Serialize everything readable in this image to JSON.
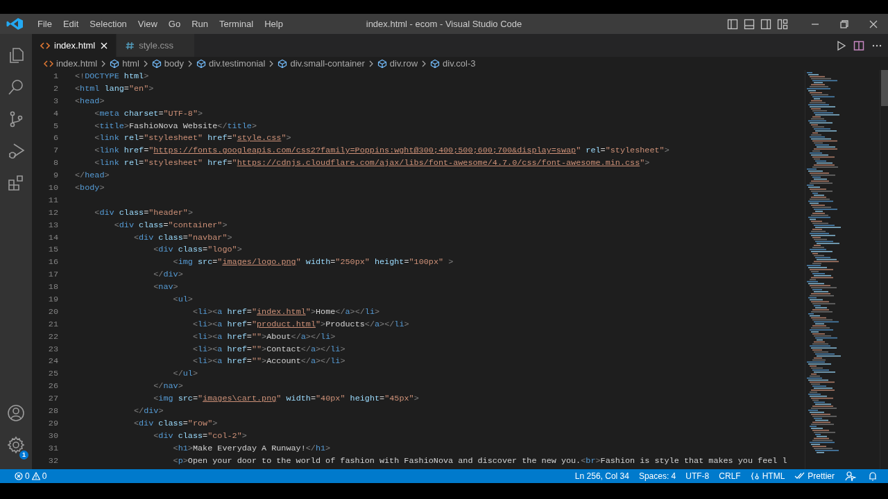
{
  "window": {
    "title": "index.html - ecom - Visual Studio Code"
  },
  "menu": [
    "File",
    "Edit",
    "Selection",
    "View",
    "Go",
    "Run",
    "Terminal",
    "Help"
  ],
  "activity_bar": {
    "settings_badge": "1"
  },
  "tabs": [
    {
      "label": "index.html",
      "kind": "html",
      "selected": true
    },
    {
      "label": "style.css",
      "kind": "css",
      "selected": false
    }
  ],
  "breadcrumbs": [
    {
      "label": "index.html",
      "kind": "file"
    },
    {
      "label": "html",
      "kind": "element"
    },
    {
      "label": "body",
      "kind": "element"
    },
    {
      "label": "div.testimonial",
      "kind": "element"
    },
    {
      "label": "div.small-container",
      "kind": "element"
    },
    {
      "label": "div.row",
      "kind": "element"
    },
    {
      "label": "div.col-3",
      "kind": "element"
    }
  ],
  "editor": {
    "lines": [
      {
        "number": "1",
        "tokens": [
          {
            "kind": "bracket",
            "text": "<!"
          },
          {
            "kind": "tag",
            "text": "DOCTYPE"
          },
          {
            "kind": "attr",
            "text": " html"
          },
          {
            "kind": "bracket",
            "text": ">"
          }
        ]
      },
      {
        "number": "2",
        "tokens": [
          {
            "kind": "bracket",
            "text": "<"
          },
          {
            "kind": "tag",
            "text": "html"
          },
          {
            "kind": "attr",
            "text": " lang"
          },
          {
            "kind": "text",
            "text": "="
          },
          {
            "kind": "string",
            "text": "\"en\""
          },
          {
            "kind": "bracket",
            "text": ">"
          }
        ]
      },
      {
        "number": "3",
        "tokens": [
          {
            "kind": "bracket",
            "text": "<"
          },
          {
            "kind": "tag",
            "text": "head"
          },
          {
            "kind": "bracket",
            "text": ">"
          }
        ]
      },
      {
        "number": "4",
        "tokens": [
          {
            "kind": "bracket",
            "text": "    <"
          },
          {
            "kind": "tag",
            "text": "meta"
          },
          {
            "kind": "attr",
            "text": " charset"
          },
          {
            "kind": "text",
            "text": "="
          },
          {
            "kind": "string",
            "text": "\"UTF-8\""
          },
          {
            "kind": "bracket",
            "text": ">"
          }
        ]
      },
      {
        "number": "5",
        "tokens": [
          {
            "kind": "bracket",
            "text": "    <"
          },
          {
            "kind": "tag",
            "text": "title"
          },
          {
            "kind": "bracket",
            "text": ">"
          },
          {
            "kind": "text",
            "text": "FashioNova Website"
          },
          {
            "kind": "bracket",
            "text": "</"
          },
          {
            "kind": "tag",
            "text": "title"
          },
          {
            "kind": "bracket",
            "text": ">"
          }
        ]
      },
      {
        "number": "6",
        "tokens": [
          {
            "kind": "bracket",
            "text": "    <"
          },
          {
            "kind": "tag",
            "text": "link"
          },
          {
            "kind": "attr",
            "text": " rel"
          },
          {
            "kind": "text",
            "text": "="
          },
          {
            "kind": "string",
            "text": "\"stylesheet\""
          },
          {
            "kind": "attr",
            "text": " href"
          },
          {
            "kind": "text",
            "text": "="
          },
          {
            "kind": "string",
            "text": "\""
          },
          {
            "kind": "link",
            "text": "style.css"
          },
          {
            "kind": "string",
            "text": "\""
          },
          {
            "kind": "bracket",
            "text": ">"
          }
        ]
      },
      {
        "number": "7",
        "tokens": [
          {
            "kind": "bracket",
            "text": "    <"
          },
          {
            "kind": "tag",
            "text": "link"
          },
          {
            "kind": "attr",
            "text": " href"
          },
          {
            "kind": "text",
            "text": "="
          },
          {
            "kind": "string",
            "text": "\""
          },
          {
            "kind": "link",
            "text": "https://fonts.googleapis.com/css2?family=Poppins:wght@300;400;500;600;700&display=swap"
          },
          {
            "kind": "string",
            "text": "\""
          },
          {
            "kind": "attr",
            "text": " rel"
          },
          {
            "kind": "text",
            "text": "="
          },
          {
            "kind": "string",
            "text": "\"stylesheet\""
          },
          {
            "kind": "bracket",
            "text": ">"
          }
        ]
      },
      {
        "number": "8",
        "tokens": [
          {
            "kind": "bracket",
            "text": "    <"
          },
          {
            "kind": "tag",
            "text": "link"
          },
          {
            "kind": "attr",
            "text": " rel"
          },
          {
            "kind": "text",
            "text": "="
          },
          {
            "kind": "string",
            "text": "\"stylesheet\""
          },
          {
            "kind": "attr",
            "text": " href"
          },
          {
            "kind": "text",
            "text": "="
          },
          {
            "kind": "string",
            "text": "\""
          },
          {
            "kind": "link",
            "text": "https://cdnjs.cloudflare.com/ajax/libs/font-awesome/4.7.0/css/font-awesome.min.css"
          },
          {
            "kind": "string",
            "text": "\""
          },
          {
            "kind": "bracket",
            "text": ">"
          }
        ]
      },
      {
        "number": "9",
        "tokens": [
          {
            "kind": "bracket",
            "text": "</"
          },
          {
            "kind": "tag",
            "text": "head"
          },
          {
            "kind": "bracket",
            "text": ">"
          }
        ]
      },
      {
        "number": "10",
        "tokens": [
          {
            "kind": "bracket",
            "text": "<"
          },
          {
            "kind": "tag",
            "text": "body"
          },
          {
            "kind": "bracket",
            "text": ">"
          }
        ]
      },
      {
        "number": "11"
      },
      {
        "number": "12",
        "tokens": [
          {
            "kind": "bracket",
            "text": "    <"
          },
          {
            "kind": "tag",
            "text": "div"
          },
          {
            "kind": "attr",
            "text": " class"
          },
          {
            "kind": "text",
            "text": "="
          },
          {
            "kind": "string",
            "text": "\"header\""
          },
          {
            "kind": "bracket",
            "text": ">"
          }
        ]
      },
      {
        "number": "13",
        "tokens": [
          {
            "kind": "bracket",
            "text": "        <"
          },
          {
            "kind": "tag",
            "text": "div"
          },
          {
            "kind": "attr",
            "text": " class"
          },
          {
            "kind": "text",
            "text": "="
          },
          {
            "kind": "string",
            "text": "\"container\""
          },
          {
            "kind": "bracket",
            "text": ">"
          }
        ]
      },
      {
        "number": "14",
        "tokens": [
          {
            "kind": "bracket",
            "text": "            <"
          },
          {
            "kind": "tag",
            "text": "div"
          },
          {
            "kind": "attr",
            "text": " class"
          },
          {
            "kind": "text",
            "text": "="
          },
          {
            "kind": "string",
            "text": "\"navbar\""
          },
          {
            "kind": "bracket",
            "text": ">"
          }
        ]
      },
      {
        "number": "15",
        "tokens": [
          {
            "kind": "bracket",
            "text": "                <"
          },
          {
            "kind": "tag",
            "text": "div"
          },
          {
            "kind": "attr",
            "text": " class"
          },
          {
            "kind": "text",
            "text": "="
          },
          {
            "kind": "string",
            "text": "\"logo\""
          },
          {
            "kind": "bracket",
            "text": ">"
          }
        ]
      },
      {
        "number": "16",
        "tokens": [
          {
            "kind": "bracket",
            "text": "                    <"
          },
          {
            "kind": "tag",
            "text": "img"
          },
          {
            "kind": "attr",
            "text": " src"
          },
          {
            "kind": "text",
            "text": "="
          },
          {
            "kind": "string",
            "text": "\""
          },
          {
            "kind": "link",
            "text": "images/logo.png"
          },
          {
            "kind": "string",
            "text": "\""
          },
          {
            "kind": "attr",
            "text": " width"
          },
          {
            "kind": "text",
            "text": "="
          },
          {
            "kind": "string",
            "text": "\"250px\""
          },
          {
            "kind": "attr",
            "text": " height"
          },
          {
            "kind": "text",
            "text": "="
          },
          {
            "kind": "string",
            "text": "\"100px\""
          },
          {
            "kind": "bracket",
            "text": " >"
          }
        ]
      },
      {
        "number": "17",
        "tokens": [
          {
            "kind": "bracket",
            "text": "                </"
          },
          {
            "kind": "tag",
            "text": "div"
          },
          {
            "kind": "bracket",
            "text": ">"
          }
        ]
      },
      {
        "number": "18",
        "tokens": [
          {
            "kind": "bracket",
            "text": "                <"
          },
          {
            "kind": "tag",
            "text": "nav"
          },
          {
            "kind": "bracket",
            "text": ">"
          }
        ]
      },
      {
        "number": "19",
        "tokens": [
          {
            "kind": "bracket",
            "text": "                    <"
          },
          {
            "kind": "tag",
            "text": "ul"
          },
          {
            "kind": "bracket",
            "text": ">"
          }
        ]
      },
      {
        "number": "20",
        "tokens": [
          {
            "kind": "bracket",
            "text": "                        <"
          },
          {
            "kind": "tag",
            "text": "li"
          },
          {
            "kind": "bracket",
            "text": "><"
          },
          {
            "kind": "tag",
            "text": "a"
          },
          {
            "kind": "attr",
            "text": " href"
          },
          {
            "kind": "text",
            "text": "="
          },
          {
            "kind": "string",
            "text": "\""
          },
          {
            "kind": "link",
            "text": "index.html"
          },
          {
            "kind": "string",
            "text": "\""
          },
          {
            "kind": "bracket",
            "text": ">"
          },
          {
            "kind": "text",
            "text": "Home"
          },
          {
            "kind": "bracket",
            "text": "</"
          },
          {
            "kind": "tag",
            "text": "a"
          },
          {
            "kind": "bracket",
            "text": "></"
          },
          {
            "kind": "tag",
            "text": "li"
          },
          {
            "kind": "bracket",
            "text": ">"
          }
        ]
      },
      {
        "number": "21",
        "tokens": [
          {
            "kind": "bracket",
            "text": "                        <"
          },
          {
            "kind": "tag",
            "text": "li"
          },
          {
            "kind": "bracket",
            "text": "><"
          },
          {
            "kind": "tag",
            "text": "a"
          },
          {
            "kind": "attr",
            "text": " href"
          },
          {
            "kind": "text",
            "text": "="
          },
          {
            "kind": "string",
            "text": "\""
          },
          {
            "kind": "link",
            "text": "product.html"
          },
          {
            "kind": "string",
            "text": "\""
          },
          {
            "kind": "bracket",
            "text": ">"
          },
          {
            "kind": "text",
            "text": "Products"
          },
          {
            "kind": "bracket",
            "text": "</"
          },
          {
            "kind": "tag",
            "text": "a"
          },
          {
            "kind": "bracket",
            "text": "></"
          },
          {
            "kind": "tag",
            "text": "li"
          },
          {
            "kind": "bracket",
            "text": ">"
          }
        ]
      },
      {
        "number": "22",
        "tokens": [
          {
            "kind": "bracket",
            "text": "                        <"
          },
          {
            "kind": "tag",
            "text": "li"
          },
          {
            "kind": "bracket",
            "text": "><"
          },
          {
            "kind": "tag",
            "text": "a"
          },
          {
            "kind": "attr",
            "text": " href"
          },
          {
            "kind": "text",
            "text": "="
          },
          {
            "kind": "string",
            "text": "\"\""
          },
          {
            "kind": "bracket",
            "text": ">"
          },
          {
            "kind": "text",
            "text": "About"
          },
          {
            "kind": "bracket",
            "text": "</"
          },
          {
            "kind": "tag",
            "text": "a"
          },
          {
            "kind": "bracket",
            "text": "></"
          },
          {
            "kind": "tag",
            "text": "li"
          },
          {
            "kind": "bracket",
            "text": ">"
          }
        ]
      },
      {
        "number": "23",
        "tokens": [
          {
            "kind": "bracket",
            "text": "                        <"
          },
          {
            "kind": "tag",
            "text": "li"
          },
          {
            "kind": "bracket",
            "text": "><"
          },
          {
            "kind": "tag",
            "text": "a"
          },
          {
            "kind": "attr",
            "text": " href"
          },
          {
            "kind": "text",
            "text": "="
          },
          {
            "kind": "string",
            "text": "\"\""
          },
          {
            "kind": "bracket",
            "text": ">"
          },
          {
            "kind": "text",
            "text": "Contact"
          },
          {
            "kind": "bracket",
            "text": "</"
          },
          {
            "kind": "tag",
            "text": "a"
          },
          {
            "kind": "bracket",
            "text": "></"
          },
          {
            "kind": "tag",
            "text": "li"
          },
          {
            "kind": "bracket",
            "text": ">"
          }
        ]
      },
      {
        "number": "24",
        "tokens": [
          {
            "kind": "bracket",
            "text": "                        <"
          },
          {
            "kind": "tag",
            "text": "li"
          },
          {
            "kind": "bracket",
            "text": "><"
          },
          {
            "kind": "tag",
            "text": "a"
          },
          {
            "kind": "attr",
            "text": " href"
          },
          {
            "kind": "text",
            "text": "="
          },
          {
            "kind": "string",
            "text": "\"\""
          },
          {
            "kind": "bracket",
            "text": ">"
          },
          {
            "kind": "text",
            "text": "Account"
          },
          {
            "kind": "bracket",
            "text": "</"
          },
          {
            "kind": "tag",
            "text": "a"
          },
          {
            "kind": "bracket",
            "text": "></"
          },
          {
            "kind": "tag",
            "text": "li"
          },
          {
            "kind": "bracket",
            "text": ">"
          }
        ]
      },
      {
        "number": "25",
        "tokens": [
          {
            "kind": "bracket",
            "text": "                    </"
          },
          {
            "kind": "tag",
            "text": "ul"
          },
          {
            "kind": "bracket",
            "text": ">"
          }
        ]
      },
      {
        "number": "26",
        "tokens": [
          {
            "kind": "bracket",
            "text": "                </"
          },
          {
            "kind": "tag",
            "text": "nav"
          },
          {
            "kind": "bracket",
            "text": ">"
          }
        ]
      },
      {
        "number": "27",
        "tokens": [
          {
            "kind": "bracket",
            "text": "                <"
          },
          {
            "kind": "tag",
            "text": "img"
          },
          {
            "kind": "attr",
            "text": " src"
          },
          {
            "kind": "text",
            "text": "="
          },
          {
            "kind": "string",
            "text": "\""
          },
          {
            "kind": "link",
            "text": "images\\cart.png"
          },
          {
            "kind": "string",
            "text": "\""
          },
          {
            "kind": "attr",
            "text": " width"
          },
          {
            "kind": "text",
            "text": "="
          },
          {
            "kind": "string",
            "text": "\"40px\""
          },
          {
            "kind": "attr",
            "text": " height"
          },
          {
            "kind": "text",
            "text": "="
          },
          {
            "kind": "string",
            "text": "\"45px\""
          },
          {
            "kind": "bracket",
            "text": ">"
          }
        ]
      },
      {
        "number": "28",
        "tokens": [
          {
            "kind": "bracket",
            "text": "            </"
          },
          {
            "kind": "tag",
            "text": "div"
          },
          {
            "kind": "bracket",
            "text": ">"
          }
        ]
      },
      {
        "number": "29",
        "tokens": [
          {
            "kind": "bracket",
            "text": "            <"
          },
          {
            "kind": "tag",
            "text": "div"
          },
          {
            "kind": "attr",
            "text": " class"
          },
          {
            "kind": "text",
            "text": "="
          },
          {
            "kind": "string",
            "text": "\"row\""
          },
          {
            "kind": "bracket",
            "text": ">"
          }
        ]
      },
      {
        "number": "30",
        "tokens": [
          {
            "kind": "bracket",
            "text": "                <"
          },
          {
            "kind": "tag",
            "text": "div"
          },
          {
            "kind": "attr",
            "text": " class"
          },
          {
            "kind": "text",
            "text": "="
          },
          {
            "kind": "string",
            "text": "\"col-2\""
          },
          {
            "kind": "bracket",
            "text": ">"
          }
        ]
      },
      {
        "number": "31",
        "tokens": [
          {
            "kind": "bracket",
            "text": "                    <"
          },
          {
            "kind": "tag",
            "text": "h1"
          },
          {
            "kind": "bracket",
            "text": ">"
          },
          {
            "kind": "text",
            "text": "Make Everyday A Runway!"
          },
          {
            "kind": "bracket",
            "text": "</"
          },
          {
            "kind": "tag",
            "text": "h1"
          },
          {
            "kind": "bracket",
            "text": ">"
          }
        ]
      },
      {
        "number": "32",
        "tokens": [
          {
            "kind": "bracket",
            "text": "                    <"
          },
          {
            "kind": "tag",
            "text": "p"
          },
          {
            "kind": "bracket",
            "text": ">"
          },
          {
            "kind": "text",
            "text": "Open your door to the world of fashion with FashioNova and discover the new you."
          },
          {
            "kind": "bracket",
            "text": "<"
          },
          {
            "kind": "tag",
            "text": "br"
          },
          {
            "kind": "bracket",
            "text": ">"
          },
          {
            "kind": "text",
            "text": "Fashion is style that makes you feel l"
          }
        ]
      }
    ]
  },
  "status_bar": {
    "errors": "0",
    "warnings": "0",
    "items": [
      {
        "kind": "text",
        "text": "Ln 256, Col 34"
      },
      {
        "kind": "text",
        "text": "Spaces: 4"
      },
      {
        "kind": "text",
        "text": "UTF-8"
      },
      {
        "kind": "text",
        "text": "CRLF"
      },
      {
        "kind": "language",
        "text": "HTML"
      },
      {
        "kind": "formatter",
        "text": "Prettier"
      },
      {
        "kind": "feedback"
      },
      {
        "kind": "notifications"
      }
    ]
  }
}
